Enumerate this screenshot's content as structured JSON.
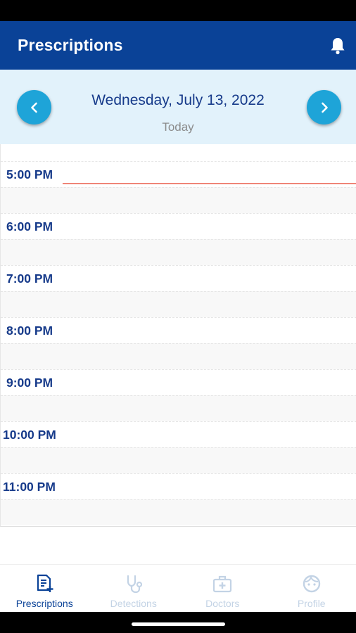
{
  "app_bar": {
    "title": "Prescriptions",
    "notification_icon": "bell-icon"
  },
  "date_header": {
    "date": "Wednesday, July 13, 2022",
    "subtitle": "Today",
    "prev_icon": "chevron-left-icon",
    "next_icon": "chevron-right-icon"
  },
  "schedule": {
    "time_slots": [
      "5:00 PM",
      "6:00 PM",
      "7:00 PM",
      "8:00 PM",
      "9:00 PM",
      "10:00 PM",
      "11:00 PM"
    ],
    "current_time_indicator_color": "#ef8577"
  },
  "bottom_nav": {
    "tabs": [
      {
        "label": "Prescriptions",
        "icon": "prescription-icon",
        "active": true
      },
      {
        "label": "Detections",
        "icon": "stethoscope-icon",
        "active": false
      },
      {
        "label": "Doctors",
        "icon": "medical-kit-icon",
        "active": false
      },
      {
        "label": "Profile",
        "icon": "face-icon",
        "active": false
      }
    ]
  },
  "colors": {
    "primary": "#0a4297",
    "accent": "#1ea4d8",
    "header_bg": "#e2f2fb",
    "inactive_tab": "#c3d3e5"
  }
}
